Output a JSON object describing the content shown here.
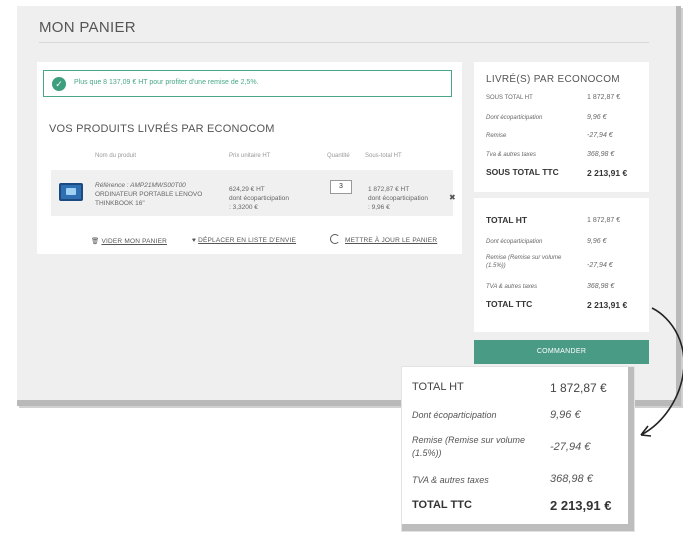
{
  "page": {
    "title": "MON PANIER"
  },
  "notice": {
    "text": "Plus que 8 137,09 € HT pour profiter d'une remise de 2,5%."
  },
  "products": {
    "section_title": "VOS PRODUITS LIVRÉS PAR ECONOCOM",
    "headers": {
      "name": "Nom du produit",
      "price": "Prix unitaire HT",
      "qty": "Quantité",
      "subtotal": "Sous-total HT"
    },
    "item": {
      "reference": "Référence : AMP21MWS00T00",
      "name_line1": "ORDINATEUR PORTABLE LENOVO",
      "name_line2": "THINKBOOK 16\"",
      "price_line1": "624,29 € HT",
      "price_line2": "dont écoparticipation",
      "price_line3": ": 3,3200 €",
      "quantity": "3",
      "subtotal_line1": "1 872,87 € HT",
      "subtotal_line2": "dont écoparticipation",
      "subtotal_line3": ": 9,96 €",
      "remove_icon": "close-icon"
    },
    "actions": {
      "empty_cart": "VIDER MON PANIER",
      "wishlist": "DÉPLACER EN LISTE D'ENVIE",
      "update_cart": "METTRE À JOUR LE PANIER"
    }
  },
  "summary1": {
    "title": "LIVRÉ(S) PAR ECONOCOM",
    "rows": [
      {
        "label": "SOUS TOTAL HT",
        "value": "1 872,87 €"
      },
      {
        "label": "Dont écoparticipation",
        "value": "9,96 €"
      },
      {
        "label": "Remise",
        "value": "-27,94 €"
      },
      {
        "label": "Tva & autres taxes",
        "value": "368,98 €"
      },
      {
        "label": "SOUS TOTAL TTC",
        "value": "2 213,91 €"
      }
    ]
  },
  "summary2": {
    "rows": [
      {
        "label": "TOTAL HT",
        "value": "1 872,87 €"
      },
      {
        "label": "Dont écoparticipation",
        "value": "9,96 €"
      },
      {
        "label": "Remise (Remise sur volume (1.5%))",
        "value": "-27,94 €"
      },
      {
        "label": "TVA & autres taxes",
        "value": "368,98 €"
      },
      {
        "label": "TOTAL TTC",
        "value": "2 213,91 €"
      }
    ]
  },
  "order_button": "COMMANDER",
  "zoom": {
    "rows": [
      {
        "label": "TOTAL HT",
        "value": "1 872,87 €"
      },
      {
        "label": "Dont écoparticipation",
        "value": "9,96 €"
      },
      {
        "label": "Remise (Remise sur volume (1.5%))",
        "value": "-27,94 €"
      },
      {
        "label": "TVA & autres taxes",
        "value": "368,98 €"
      },
      {
        "label": "TOTAL TTC",
        "value": "2 213,91 €"
      }
    ]
  },
  "colors": {
    "accent": "#4a9b85",
    "notice_border": "#49a78a"
  }
}
